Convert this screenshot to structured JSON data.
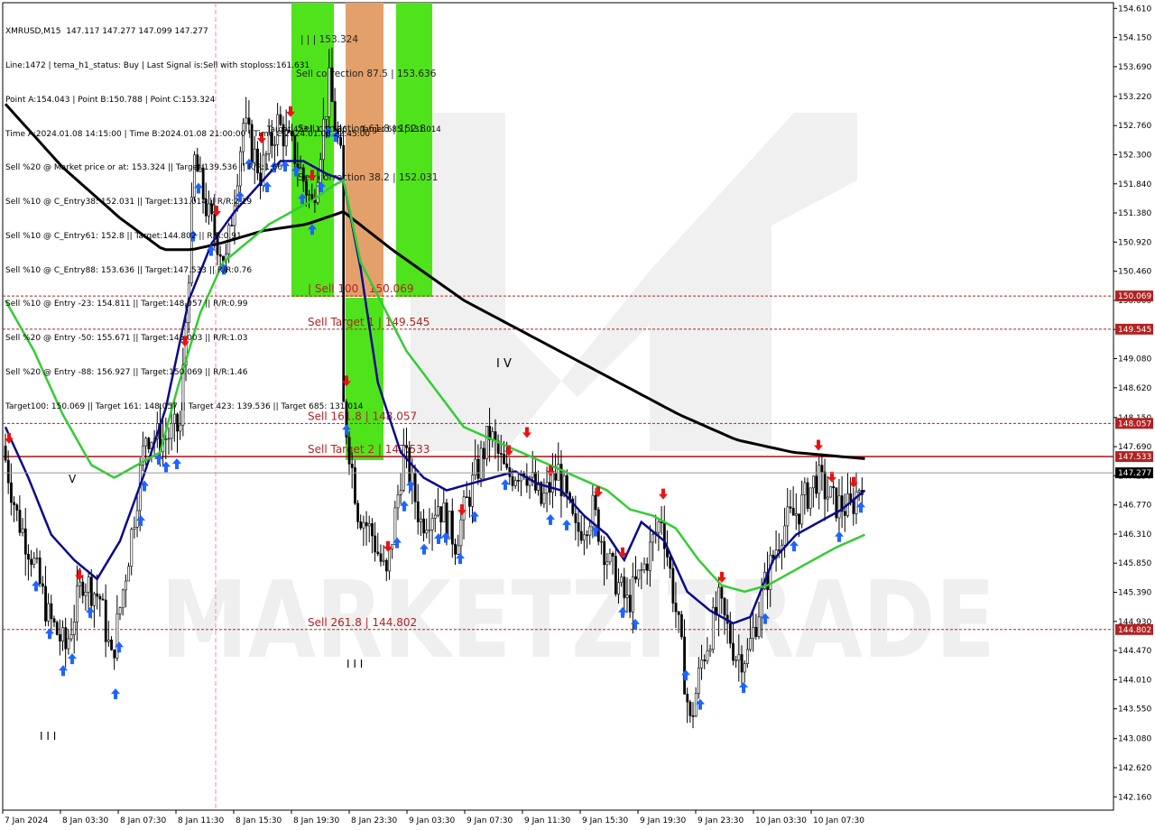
{
  "info": {
    "lines": [
      "XMRUSD,M15  147.117 147.277 147.099 147.277",
      "Line:1472 | tema_h1_status: Buy | Last Signal is:Sell with stoploss:161.631",
      "Point A:154.043 | Point B:150.788 | Point C:153.324",
      "Time A:2024.01.08 14:15:00 | Time B:2024.01.08 21:00:00 | Time C:2024.01.08 22:45:00",
      "Sell %20 @ Market price or at: 153.324 || Target:139.536 || R/R:1.66",
      "Sell %10 @ C_Entry38: 152.031 || Target:131.014 || R/R:2.19",
      "Sell %10 @ C_Entry61: 152.8 || Target:144.802 || R/R:0.91",
      "Sell %10 @ C_Entry88: 153.636 || Target:147.533 || R/R:0.76",
      "Sell %10 @ Entry -23: 154.811 || Target:148.057 || R/R:0.99",
      "Sell %20 @ Entry -50: 155.671 || Target:145.003 || R/R:1.03",
      "Sell %20 @ Entry -88: 156.927 || Target:150.069 || R/R:1.46",
      "Target100: 150.069 || Target 161: 148.057 || Target 423: 139.536 || Target 685: 131.014"
    ]
  },
  "watermark": {
    "text": "MARKETZITRADE"
  },
  "zones": {
    "top_label": "| | | 153.324",
    "correction_87": "Sell correction 87.5 | 153.636",
    "correction_61": "Sell correction 61.8 | 152.8",
    "correction_38": "Sell correction 38.2 | 152.031",
    "target_423": "Target 423 | 139.536",
    "target_685": "Target 685 | 131.014"
  },
  "levels": [
    {
      "price": 150.069,
      "label": "| Sell 100 | 150.069",
      "tag": "150.069"
    },
    {
      "price": 149.545,
      "label": "Sell Target 1 | 149.545",
      "tag": "149.545"
    },
    {
      "price": 148.057,
      "label": "Sell 161.8 | 148.057",
      "tag": "148.057"
    },
    {
      "price": 147.533,
      "label": "Sell Target 2 | 147.533",
      "tag": "147.533"
    },
    {
      "price": 144.802,
      "label": "Sell 261.8 | 144.802",
      "tag": "144.802"
    }
  ],
  "current_price": {
    "price": 147.277,
    "tag": "147.277"
  },
  "wave_marks": {
    "iv": "I V",
    "wave_v": "V",
    "iii_bottom": "I I I",
    "iii_center": "I I I"
  },
  "colors": {
    "level_line": "#b22222",
    "level_tag": "#b22222",
    "current_tag": "#000000",
    "zone_green": "#4fe31c",
    "zone_orange": "#e3a06a",
    "ma_black": "#000000",
    "ma_navy": "#0a0a8c",
    "ma_green": "#33cc33",
    "candle": "#000000",
    "vline": "#ff80c0"
  },
  "chart_data": {
    "type": "candlestick",
    "symbol": "XMRUSD",
    "timeframe": "M15",
    "y_axis": {
      "min": 141.95,
      "max": 154.7,
      "ticks": [
        "154.610",
        "154.150",
        "153.690",
        "153.220",
        "152.760",
        "152.300",
        "151.840",
        "151.380",
        "150.920",
        "150.460",
        "150.000",
        "149.540",
        "149.080",
        "148.620",
        "148.150",
        "147.690",
        "147.230",
        "146.770",
        "146.310",
        "145.850",
        "145.390",
        "144.930",
        "144.470",
        "144.010",
        "143.550",
        "143.080",
        "142.620",
        "142.160"
      ]
    },
    "x_axis": {
      "ticks": [
        "7 Jan 2024",
        "8 Jan 03:30",
        "8 Jan 07:30",
        "8 Jan 11:30",
        "8 Jan 15:30",
        "8 Jan 19:30",
        "8 Jan 23:30",
        "9 Jan 03:30",
        "9 Jan 07:30",
        "9 Jan 11:30",
        "9 Jan 15:30",
        "9 Jan 19:30",
        "9 Jan 23:30",
        "10 Jan 03:30",
        "10 Jan 07:30"
      ]
    },
    "anchors": [
      [
        0,
        147.7
      ],
      [
        5,
        146.6
      ],
      [
        10,
        146.0
      ],
      [
        16,
        145.0
      ],
      [
        22,
        144.5
      ],
      [
        28,
        145.6
      ],
      [
        34,
        145.3
      ],
      [
        38,
        144.3
      ],
      [
        44,
        146.0
      ],
      [
        50,
        147.9
      ],
      [
        56,
        147.8
      ],
      [
        62,
        148.0
      ],
      [
        67,
        152.2
      ],
      [
        72,
        151.3
      ],
      [
        78,
        150.6
      ],
      [
        84,
        152.8
      ],
      [
        90,
        152.0
      ],
      [
        96,
        152.8
      ],
      [
        102,
        152.3
      ],
      [
        108,
        151.5
      ],
      [
        114,
        153.4
      ],
      [
        118,
        152.2
      ],
      [
        119,
        148.3
      ],
      [
        124,
        146.7
      ],
      [
        129,
        146.3
      ],
      [
        134,
        145.6
      ],
      [
        140,
        147.6
      ],
      [
        146,
        146.5
      ],
      [
        152,
        146.8
      ],
      [
        158,
        146.2
      ],
      [
        164,
        147.1
      ],
      [
        170,
        147.9
      ],
      [
        176,
        147.2
      ],
      [
        182,
        147.4
      ],
      [
        188,
        146.8
      ],
      [
        194,
        147.3
      ],
      [
        200,
        146.3
      ],
      [
        206,
        146.7
      ],
      [
        212,
        145.8
      ],
      [
        218,
        145.2
      ],
      [
        224,
        145.8
      ],
      [
        230,
        146.6
      ],
      [
        236,
        144.8
      ],
      [
        240,
        143.3
      ],
      [
        244,
        144.3
      ],
      [
        250,
        145.2
      ],
      [
        256,
        144.4
      ],
      [
        260,
        144.4
      ],
      [
        266,
        145.5
      ],
      [
        272,
        146.4
      ],
      [
        278,
        146.7
      ],
      [
        284,
        147.2
      ],
      [
        290,
        146.8
      ],
      [
        296,
        146.7
      ],
      [
        300,
        147.2
      ]
    ],
    "ma_slow": [
      [
        0,
        153.1
      ],
      [
        20,
        152.1
      ],
      [
        40,
        151.3
      ],
      [
        55,
        150.8
      ],
      [
        65,
        150.8
      ],
      [
        75,
        150.9
      ],
      [
        90,
        151.1
      ],
      [
        105,
        151.2
      ],
      [
        118,
        151.4
      ],
      [
        135,
        150.8
      ],
      [
        160,
        150.0
      ],
      [
        185,
        149.4
      ],
      [
        210,
        148.8
      ],
      [
        235,
        148.2
      ],
      [
        255,
        147.8
      ],
      [
        275,
        147.6
      ],
      [
        300,
        147.5
      ]
    ],
    "ma_mid": [
      [
        0,
        148.0
      ],
      [
        8,
        147.2
      ],
      [
        16,
        146.3
      ],
      [
        24,
        145.9
      ],
      [
        32,
        145.6
      ],
      [
        40,
        146.2
      ],
      [
        48,
        147.2
      ],
      [
        56,
        148.3
      ],
      [
        64,
        150.0
      ],
      [
        72,
        150.9
      ],
      [
        80,
        151.4
      ],
      [
        88,
        151.8
      ],
      [
        96,
        152.2
      ],
      [
        104,
        152.2
      ],
      [
        112,
        152.0
      ],
      [
        118,
        151.9
      ],
      [
        124,
        150.5
      ],
      [
        130,
        148.7
      ],
      [
        138,
        147.6
      ],
      [
        146,
        147.2
      ],
      [
        154,
        147.0
      ],
      [
        162,
        147.1
      ],
      [
        170,
        147.2
      ],
      [
        178,
        147.3
      ],
      [
        186,
        147.1
      ],
      [
        194,
        147.0
      ],
      [
        202,
        146.6
      ],
      [
        210,
        146.3
      ],
      [
        216,
        145.9
      ],
      [
        222,
        146.5
      ],
      [
        230,
        146.2
      ],
      [
        238,
        145.4
      ],
      [
        246,
        145.1
      ],
      [
        254,
        144.9
      ],
      [
        260,
        145.0
      ],
      [
        268,
        145.9
      ],
      [
        276,
        146.3
      ],
      [
        284,
        146.5
      ],
      [
        292,
        146.7
      ],
      [
        300,
        147.0
      ]
    ],
    "ma_fast": [
      [
        0,
        150.0
      ],
      [
        10,
        149.2
      ],
      [
        20,
        148.2
      ],
      [
        30,
        147.4
      ],
      [
        38,
        147.2
      ],
      [
        46,
        147.4
      ],
      [
        54,
        147.6
      ],
      [
        60,
        148.6
      ],
      [
        68,
        149.8
      ],
      [
        76,
        150.6
      ],
      [
        84,
        150.9
      ],
      [
        92,
        151.2
      ],
      [
        100,
        151.4
      ],
      [
        108,
        151.6
      ],
      [
        114,
        151.8
      ],
      [
        118,
        151.9
      ],
      [
        124,
        150.6
      ],
      [
        132,
        149.9
      ],
      [
        140,
        149.2
      ],
      [
        150,
        148.6
      ],
      [
        160,
        148.0
      ],
      [
        170,
        147.8
      ],
      [
        180,
        147.6
      ],
      [
        190,
        147.4
      ],
      [
        200,
        147.2
      ],
      [
        210,
        147.0
      ],
      [
        218,
        146.7
      ],
      [
        226,
        146.6
      ],
      [
        234,
        146.4
      ],
      [
        242,
        145.9
      ],
      [
        250,
        145.5
      ],
      [
        258,
        145.4
      ],
      [
        266,
        145.5
      ],
      [
        274,
        145.7
      ],
      [
        282,
        145.9
      ],
      [
        290,
        146.1
      ],
      [
        300,
        146.3
      ]
    ]
  }
}
